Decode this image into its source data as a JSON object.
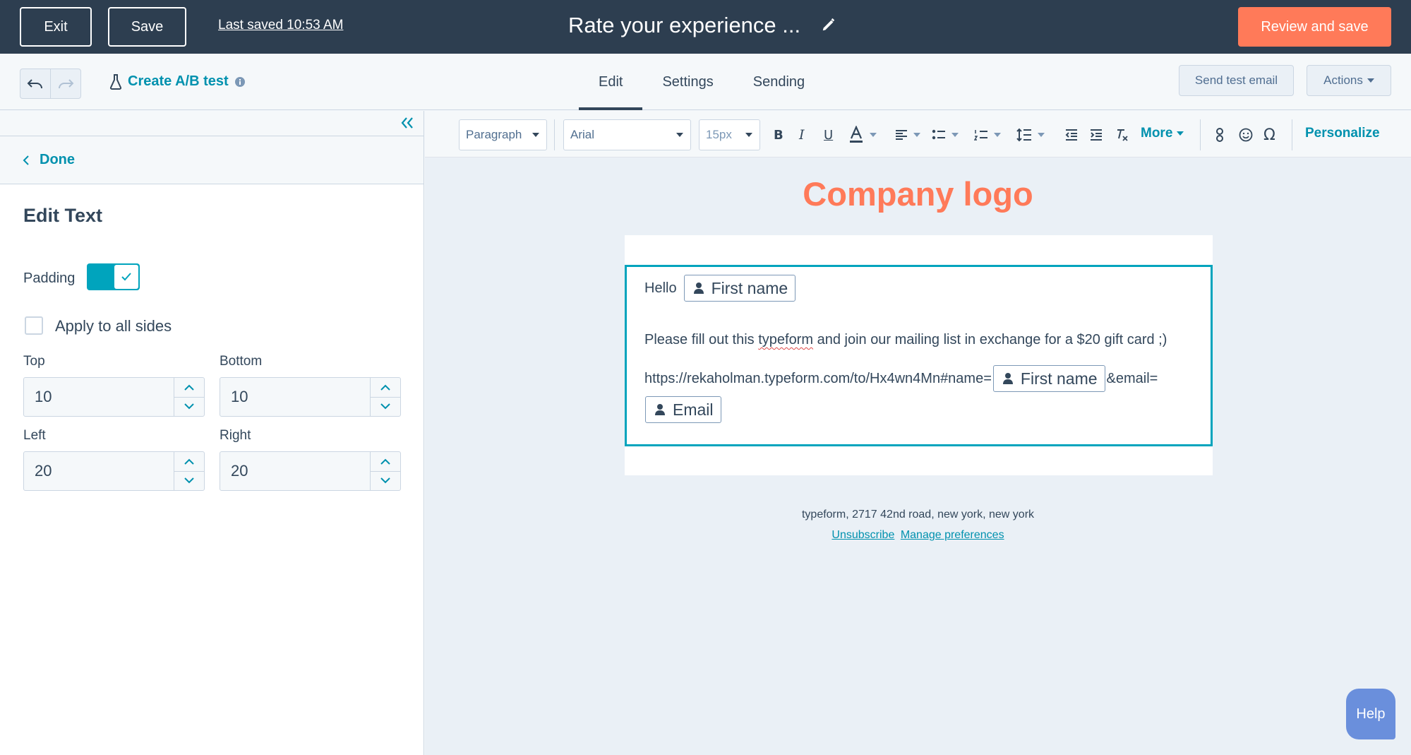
{
  "topbar": {
    "exit_label": "Exit",
    "save_label": "Save",
    "last_saved": "Last saved 10:53 AM",
    "email_title": "Rate your experience ...",
    "review_label": "Review and save"
  },
  "subbar": {
    "ab_test_label": "Create A/B test",
    "tabs": [
      {
        "label": "Edit",
        "active": true
      },
      {
        "label": "Settings",
        "active": false
      },
      {
        "label": "Sending",
        "active": false
      }
    ],
    "send_test_label": "Send test email",
    "actions_label": "Actions"
  },
  "sidebar": {
    "done_label": "Done",
    "title": "Edit Text",
    "padding_label": "Padding",
    "padding_enabled": true,
    "apply_all_label": "Apply to all sides",
    "apply_all_checked": false,
    "fields": {
      "top": {
        "label": "Top",
        "value": "10"
      },
      "bottom": {
        "label": "Bottom",
        "value": "10"
      },
      "left": {
        "label": "Left",
        "value": "20"
      },
      "right": {
        "label": "Right",
        "value": "20"
      }
    }
  },
  "toolbar": {
    "block_style": "Paragraph",
    "font": "Arial",
    "font_size": "15px",
    "more_label": "More",
    "personalize_label": "Personalize"
  },
  "email": {
    "logo_text": "Company logo",
    "hello": "Hello",
    "first_name_token": "First name",
    "body_before": "Please fill out this ",
    "body_typeform": "typeform",
    "body_after": " and join our mailing list in exchange for a $20 gift card ;)",
    "url_text": "https://rekaholman.typeform.com/to/Hx4wn4Mn#name=",
    "email_param": "&email=",
    "email_token": "Email",
    "footer_address": "typeform, 2717 42nd road, new york, new york",
    "unsubscribe": "Unsubscribe",
    "manage_prefs": "Manage preferences"
  },
  "help_label": "Help",
  "colors": {
    "topbar_bg": "#2d3e50",
    "accent_orange": "#ff7a59",
    "accent_teal": "#00a4bd",
    "link": "#0091ae"
  }
}
